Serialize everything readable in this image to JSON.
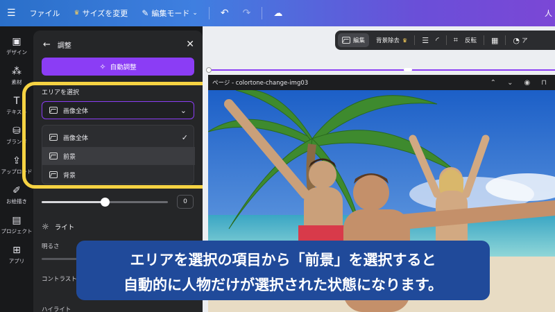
{
  "topbar": {
    "file": "ファイル",
    "resize": "サイズを変更",
    "edit_mode": "編集モード",
    "user_cut": "人"
  },
  "rail": [
    {
      "label": "デザイン",
      "icon": "design-icon"
    },
    {
      "label": "素材",
      "icon": "elements-icon"
    },
    {
      "label": "テキスト",
      "icon": "text-icon"
    },
    {
      "label": "ブランド",
      "icon": "brand-icon"
    },
    {
      "label": "アップロード",
      "icon": "upload-icon"
    },
    {
      "label": "お絵描き",
      "icon": "draw-icon"
    },
    {
      "label": "プロジェクト",
      "icon": "projects-icon"
    },
    {
      "label": "アプリ",
      "icon": "apps-icon"
    }
  ],
  "panel": {
    "title": "調整",
    "auto_adjust": "自動調整",
    "area_label": "エリアを選択",
    "selected": "画像全体",
    "options": [
      {
        "label": "画像全体",
        "checked": true
      },
      {
        "label": "前景",
        "checked": false
      },
      {
        "label": "背景",
        "checked": false
      }
    ],
    "slider_value": "0",
    "slider_level": 0.5,
    "light_section": "ライト",
    "brightness": "明るさ",
    "contrast": "コントラスト",
    "highlight": "ハイライト"
  },
  "context_toolbar": {
    "edit": "編集",
    "bg_remove": "背景除去",
    "flip": "反転",
    "apps_cut": "ア"
  },
  "page": {
    "label": "ページ - colortone-change-img03"
  },
  "caption": {
    "line1": "エリアを選択の項目から「前景」を選択すると",
    "line2": "自動的に人物だけが選択された状態になります。"
  },
  "colors": {
    "accent": "#8b3df5",
    "highlight_frame": "#f6d343",
    "caption_bg": "#204a9a"
  }
}
